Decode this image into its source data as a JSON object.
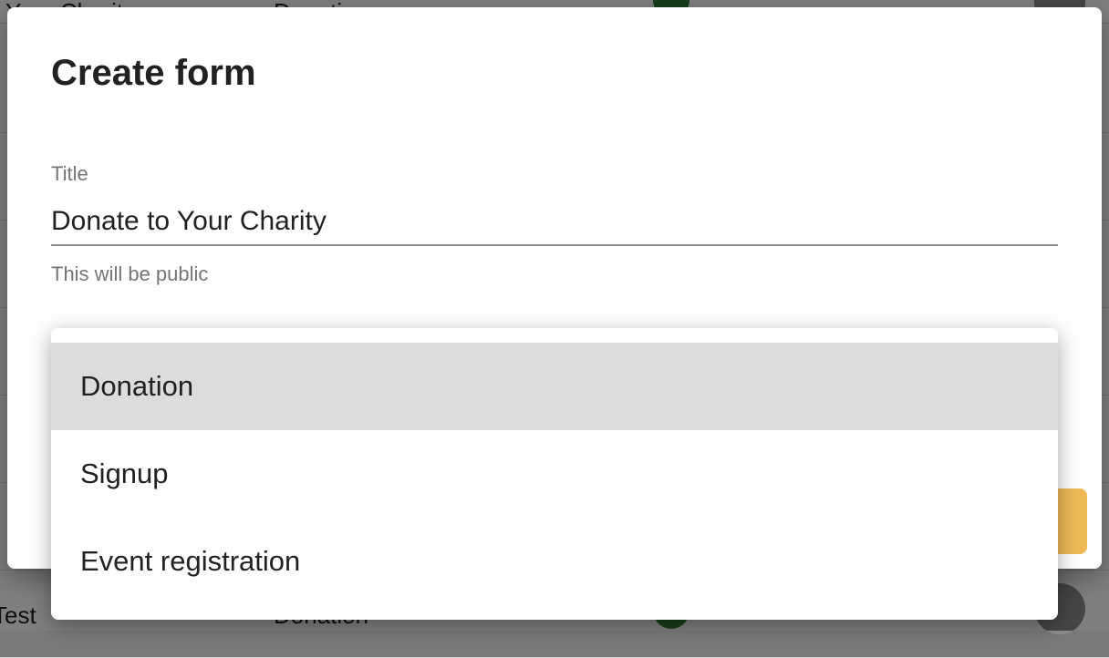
{
  "background_table": {
    "rows": [
      {
        "name": "Your Charity",
        "type": "Donation"
      },
      {
        "name": "Test",
        "type": "Donation"
      }
    ]
  },
  "dialog": {
    "title": "Create form",
    "title_field": {
      "label": "Title",
      "value": "Donate to Your Charity",
      "helper": "This will be public"
    }
  },
  "type_menu": {
    "items": [
      {
        "label": "Donation",
        "selected": true
      },
      {
        "label": "Signup",
        "selected": false
      },
      {
        "label": "Event registration",
        "selected": false
      }
    ]
  },
  "colors": {
    "accent_button": "#f0bb57",
    "selected_item_bg": "#dcdcdc",
    "status_green": "#2e7d32"
  }
}
